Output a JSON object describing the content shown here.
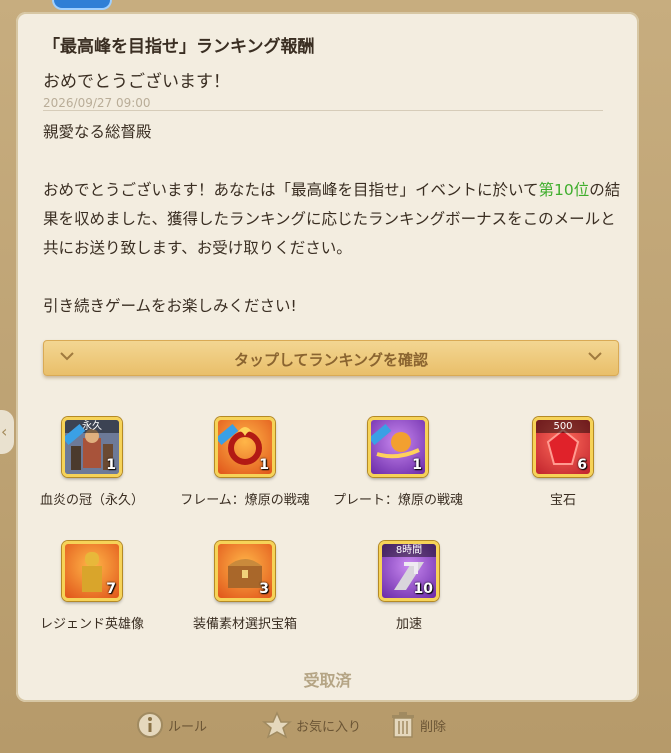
{
  "mail": {
    "title": "「最高峰を目指せ」ランキング報酬",
    "subtitle": "おめでとうございます！",
    "date": "2026/09/27 09:00",
    "greeting": "親愛なる総督殿",
    "body_p1_a": "おめでとうございます！あなたは「最高峰を目指せ」イベントに於いて",
    "body_p1_highlight": "第10位",
    "body_p1_b": "の結果を収めました、獲得したランキングに応じたランキングボーナスをこのメールと共にお送り致します、お受け取りください。",
    "body_p2": "引き続きゲームをお楽しみください!",
    "highlight_color": "#3fae2d"
  },
  "ranking_toggle": {
    "label": "タップしてランキングを確認"
  },
  "rewards": [
    {
      "name": "血炎の冠（永久）",
      "qty": "1",
      "tag": "永久",
      "icon": "crown-character-icon"
    },
    {
      "name": "フレーム：燎原の戦魂",
      "qty": "1",
      "tag": "",
      "icon": "flame-frame-icon"
    },
    {
      "name": "プレート：燎原の戦魂",
      "qty": "1",
      "tag": "",
      "icon": "plate-icon"
    },
    {
      "name": "宝石",
      "qty": "6",
      "tag": "500",
      "icon": "gem-icon"
    },
    {
      "name": "レジェンド英雄像",
      "qty": "7",
      "tag": "",
      "icon": "hero-statue-icon"
    },
    {
      "name": "装備素材選択宝箱",
      "qty": "3",
      "tag": "",
      "icon": "treasure-chest-icon"
    },
    {
      "name": "加速",
      "qty": "10",
      "tag": "8時間",
      "icon": "speedup-icon"
    }
  ],
  "status": {
    "received_label": "受取済"
  },
  "actions": {
    "rules_label": "ルール",
    "favorite_label": "お気に入り",
    "delete_label": "削除"
  }
}
